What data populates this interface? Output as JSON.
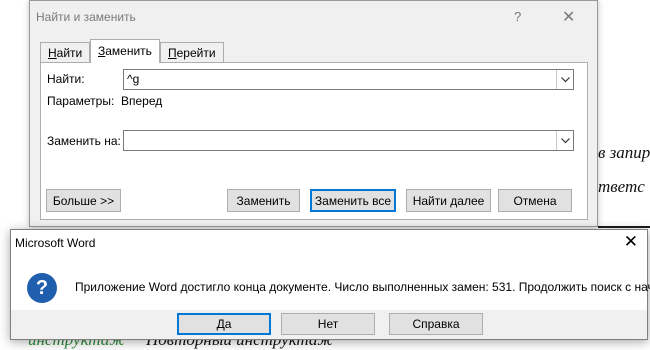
{
  "find_replace": {
    "title": "Найти и заменить",
    "help_glyph": "?",
    "close_glyph": "✕",
    "tabs": [
      {
        "label": "Найти",
        "hotkey": "Н",
        "rest": "айти"
      },
      {
        "label": "Заменить",
        "hotkey": "З",
        "rest": "аменить"
      },
      {
        "label": "Перейти",
        "hotkey": "П",
        "rest": "ерейти"
      }
    ],
    "find_label": "Найти:",
    "find_value": "^g",
    "options_label": "Параметры:",
    "options_value": "Вперед",
    "replace_label": "Заменить на:",
    "replace_value": "",
    "buttons": {
      "more": "Больше >>",
      "replace": "Заменить",
      "replace_all": "Заменить все",
      "find_next": "Найти далее",
      "cancel": "Отмена"
    }
  },
  "message_box": {
    "title": "Microsoft Word",
    "close_glyph": "✕",
    "icon": "question-icon",
    "icon_glyph": "?",
    "message": "Приложение Word достигло конца документе. Число выполненных замен: 531. Продолжить поиск с начала?",
    "buttons": {
      "yes": "Да",
      "no": "Нет",
      "help": "Справка"
    }
  },
  "document": {
    "fragment_1": "в запир",
    "fragment_2": "тветс",
    "fragment_3": "инструктаж",
    "fragment_4": "Повторный инструктаж"
  }
}
